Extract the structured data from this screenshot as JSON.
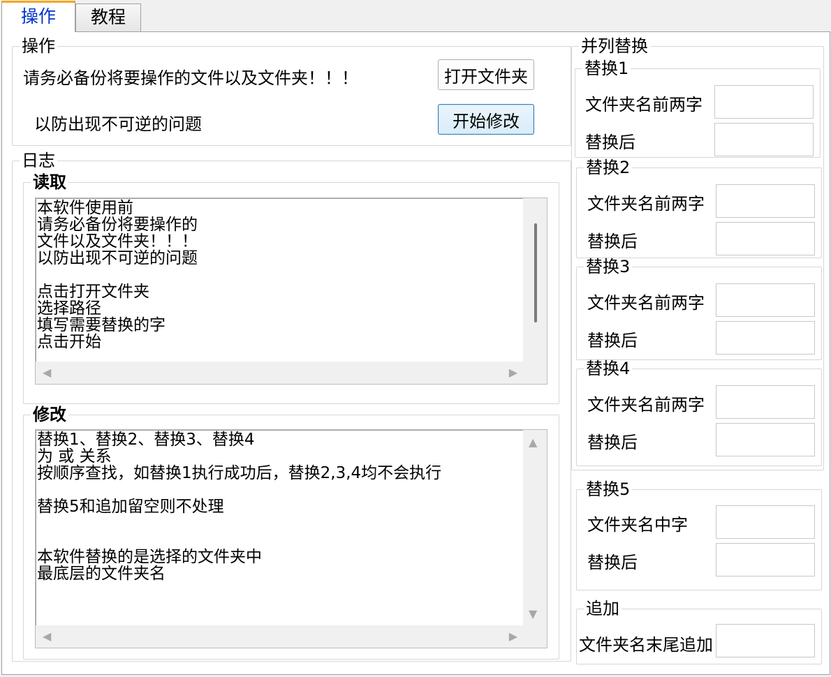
{
  "tabs": {
    "operate": "操作",
    "tutorial": "教程"
  },
  "operate_group": {
    "title": "操作",
    "warning_line1": "请务必备份将要操作的文件以及文件夹！！！",
    "warning_line2": "以防出现不可逆的问题",
    "open_folder_button": "打开文件夹",
    "start_button": "开始修改"
  },
  "log_group": {
    "title": "日志",
    "readme": {
      "title": "读取",
      "text": "本软件使用前\n请务必备份将要操作的\n文件以及文件夹！！！\n以防出现不可逆的问题\n\n点击打开文件夹\n选择路径\n填写需要替换的字\n点击开始"
    },
    "modify": {
      "title": "修改",
      "text": "替换1、替换2、替换3、替换4\n为 或 关系\n按顺序查找，如替换1执行成功后，替换2,3,4均不会执行\n\n替换5和追加留空则不处理\n\n\n本软件替换的是选择的文件夹中\n最底层的文件夹名"
    }
  },
  "parallel_group": {
    "title": "并列替换",
    "replace1": {
      "title": "替换1",
      "before_label": "文件夹名前两字",
      "after_label": "替换后",
      "before_value": "",
      "after_value": ""
    },
    "replace2": {
      "title": "替换2",
      "before_label": "文件夹名前两字",
      "after_label": "替换后",
      "before_value": "",
      "after_value": ""
    },
    "replace3": {
      "title": "替换3",
      "before_label": "文件夹名前两字",
      "after_label": "替换后",
      "before_value": "",
      "after_value": ""
    },
    "replace4": {
      "title": "替换4",
      "before_label": "文件夹名前两字",
      "after_label": "替换后",
      "before_value": "",
      "after_value": ""
    }
  },
  "replace5_group": {
    "title": "替换5",
    "before_label": "文件夹名中字",
    "after_label": "替换后",
    "before_value": "",
    "after_value": ""
  },
  "append_group": {
    "title": "追加",
    "label": "文件夹名末尾追加",
    "value": ""
  },
  "icons": {
    "scroll_left": "◀",
    "scroll_right": "▶",
    "scroll_up": "▲",
    "scroll_down": "▼"
  }
}
